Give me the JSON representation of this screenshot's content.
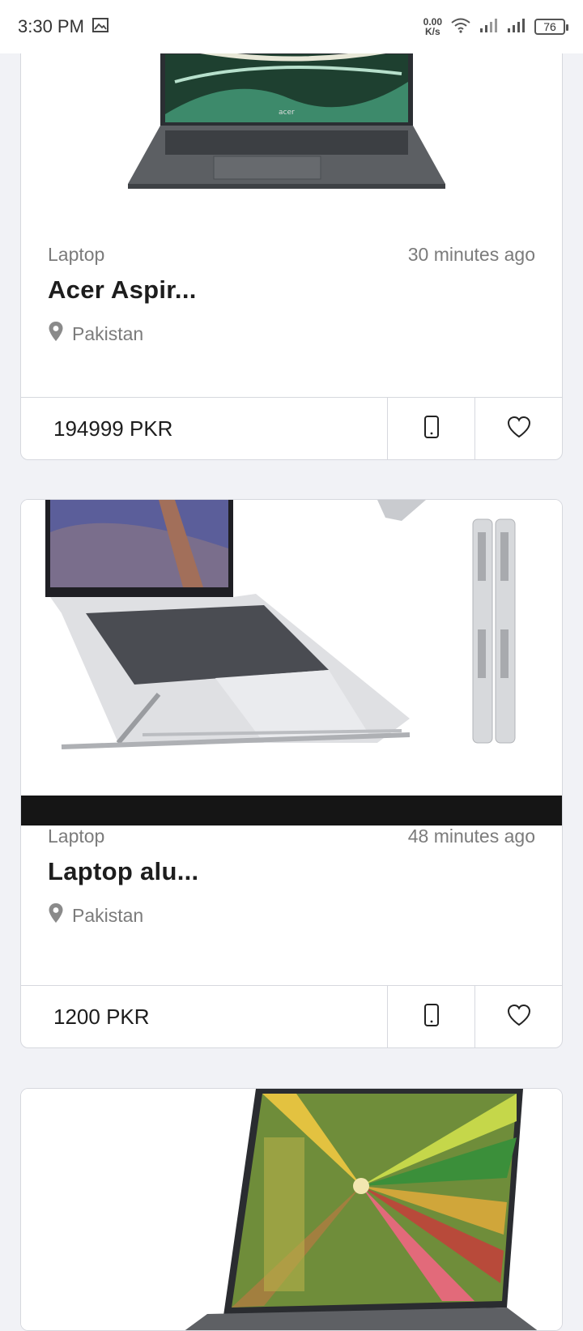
{
  "status_bar": {
    "time": "3:30 PM",
    "net_speed_value": "0.00",
    "net_speed_unit": "K/s",
    "battery": "76"
  },
  "listings": [
    {
      "category": "Laptop",
      "time_ago": "30 minutes ago",
      "title": "Acer Aspir...",
      "location": "Pakistan",
      "price": "194999 PKR"
    },
    {
      "category": "Laptop",
      "time_ago": "48 minutes ago",
      "title": "Laptop alu...",
      "location": "Pakistan",
      "price": "1200 PKR"
    },
    {
      "category": "",
      "time_ago": "",
      "title": "",
      "location": "",
      "price": ""
    }
  ],
  "icons": {
    "location": "location-pin-icon",
    "call": "phone-icon",
    "favorite": "heart-icon"
  },
  "colors": {
    "background": "#f1f2f6",
    "card": "#ffffff",
    "border": "#d6d8de",
    "muted_text": "#7b7b7b",
    "title_text": "#1d1d1d"
  }
}
